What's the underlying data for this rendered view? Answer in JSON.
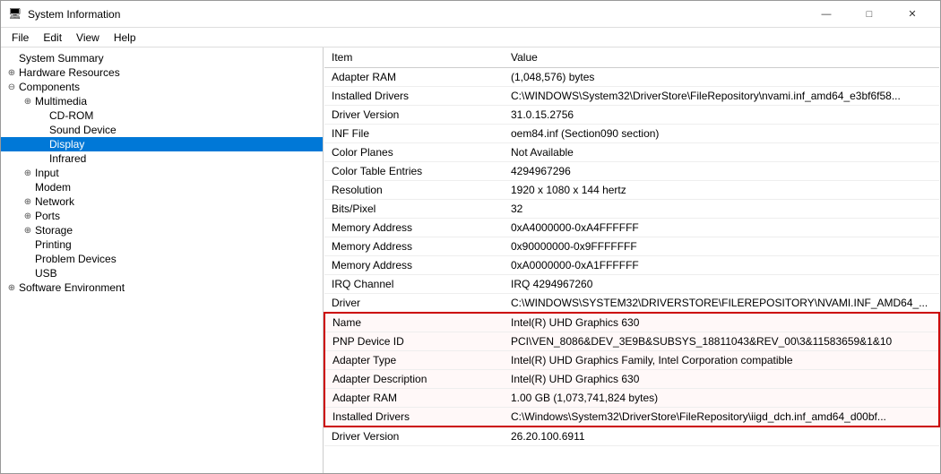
{
  "window": {
    "title": "System Information",
    "icon": "ℹ"
  },
  "menu": {
    "items": [
      "File",
      "Edit",
      "View",
      "Help"
    ]
  },
  "sidebar": {
    "items": [
      {
        "id": "system-summary",
        "label": "System Summary",
        "level": 0,
        "expanded": false,
        "hasExpander": false
      },
      {
        "id": "hardware-resources",
        "label": "Hardware Resources",
        "level": 0,
        "expanded": false,
        "hasExpander": true
      },
      {
        "id": "components",
        "label": "Components",
        "level": 0,
        "expanded": true,
        "hasExpander": true
      },
      {
        "id": "multimedia",
        "label": "Multimedia",
        "level": 1,
        "expanded": true,
        "hasExpander": true
      },
      {
        "id": "cd-rom",
        "label": "CD-ROM",
        "level": 2,
        "expanded": false,
        "hasExpander": false
      },
      {
        "id": "sound-device",
        "label": "Sound Device",
        "level": 2,
        "expanded": false,
        "hasExpander": false
      },
      {
        "id": "display",
        "label": "Display",
        "level": 2,
        "expanded": false,
        "hasExpander": false,
        "selected": true
      },
      {
        "id": "infrared",
        "label": "Infrared",
        "level": 2,
        "expanded": false,
        "hasExpander": false
      },
      {
        "id": "input",
        "label": "Input",
        "level": 1,
        "expanded": false,
        "hasExpander": true
      },
      {
        "id": "modem",
        "label": "Modem",
        "level": 1,
        "expanded": false,
        "hasExpander": false
      },
      {
        "id": "network",
        "label": "Network",
        "level": 1,
        "expanded": false,
        "hasExpander": true
      },
      {
        "id": "ports",
        "label": "Ports",
        "level": 1,
        "expanded": false,
        "hasExpander": true
      },
      {
        "id": "storage",
        "label": "Storage",
        "level": 1,
        "expanded": false,
        "hasExpander": true
      },
      {
        "id": "printing",
        "label": "Printing",
        "level": 1,
        "expanded": false,
        "hasExpander": false
      },
      {
        "id": "problem-devices",
        "label": "Problem Devices",
        "level": 1,
        "expanded": false,
        "hasExpander": false
      },
      {
        "id": "usb",
        "label": "USB",
        "level": 1,
        "expanded": false,
        "hasExpander": false
      },
      {
        "id": "software-environment",
        "label": "Software Environment",
        "level": 0,
        "expanded": false,
        "hasExpander": true
      }
    ]
  },
  "table": {
    "columns": [
      "Item",
      "Value"
    ],
    "rows": [
      {
        "item": "Adapter RAM",
        "value": "(1,048,576) bytes",
        "highlight": false
      },
      {
        "item": "Installed Drivers",
        "value": "C:\\WINDOWS\\System32\\DriverStore\\FileRepository\\nvami.inf_amd64_e3bf6f58...",
        "highlight": false
      },
      {
        "item": "Driver Version",
        "value": "31.0.15.2756",
        "highlight": false
      },
      {
        "item": "INF File",
        "value": "oem84.inf (Section090 section)",
        "highlight": false
      },
      {
        "item": "Color Planes",
        "value": "Not Available",
        "highlight": false
      },
      {
        "item": "Color Table Entries",
        "value": "4294967296",
        "highlight": false
      },
      {
        "item": "Resolution",
        "value": "1920 x 1080 x 144 hertz",
        "highlight": false
      },
      {
        "item": "Bits/Pixel",
        "value": "32",
        "highlight": false
      },
      {
        "item": "Memory Address",
        "value": "0xA4000000-0xA4FFFFFF",
        "highlight": false
      },
      {
        "item": "Memory Address",
        "value": "0x90000000-0x9FFFFFFF",
        "highlight": false
      },
      {
        "item": "Memory Address",
        "value": "0xA0000000-0xA1FFFFFF",
        "highlight": false
      },
      {
        "item": "IRQ Channel",
        "value": "IRQ 4294967260",
        "highlight": false
      },
      {
        "item": "Driver",
        "value": "C:\\WINDOWS\\SYSTEM32\\DRIVERSTORE\\FILEREPOSITORY\\NVAMI.INF_AMD64_...",
        "highlight": false
      },
      {
        "item": "Name",
        "value": "Intel(R) UHD Graphics 630",
        "highlight": true
      },
      {
        "item": "PNP Device ID",
        "value": "PCI\\VEN_8086&DEV_3E9B&SUBSYS_18811043&REV_00\\3&11583659&1&10",
        "highlight": true
      },
      {
        "item": "Adapter Type",
        "value": "Intel(R) UHD Graphics Family, Intel Corporation compatible",
        "highlight": true
      },
      {
        "item": "Adapter Description",
        "value": "Intel(R) UHD Graphics 630",
        "highlight": true
      },
      {
        "item": "Adapter RAM",
        "value": "1.00 GB (1,073,741,824 bytes)",
        "highlight": true
      },
      {
        "item": "Installed Drivers",
        "value": "C:\\Windows\\System32\\DriverStore\\FileRepository\\iigd_dch.inf_amd64_d00bf...",
        "highlight": true
      },
      {
        "item": "Driver Version",
        "value": "26.20.100.6911",
        "highlight": false
      }
    ]
  }
}
